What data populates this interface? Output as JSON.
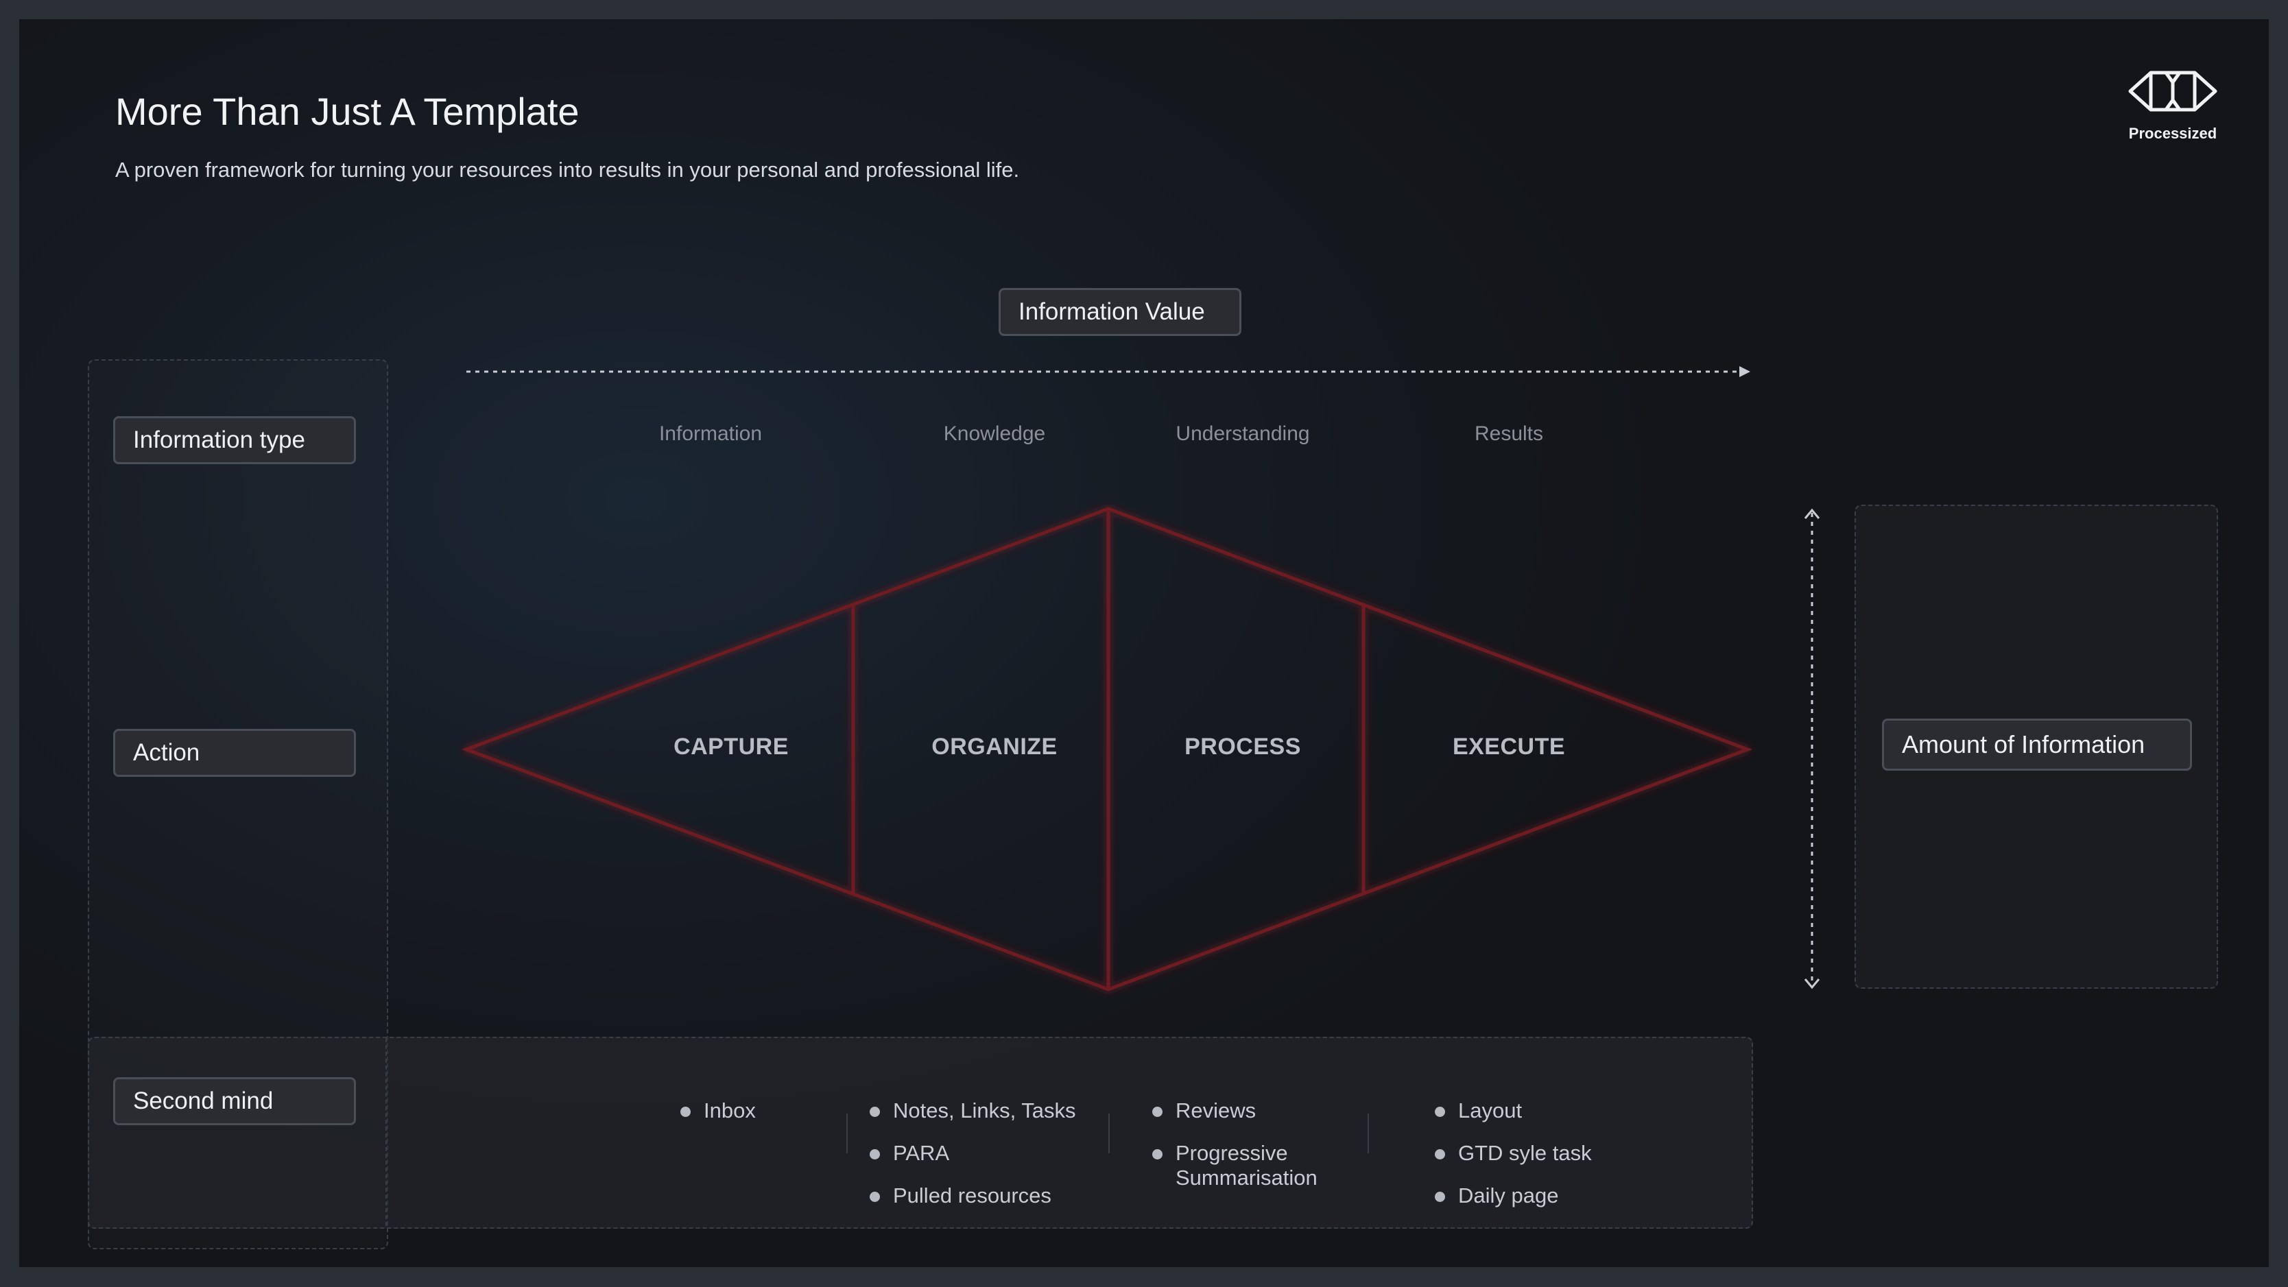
{
  "header": {
    "title": "More Than Just A Template",
    "subtitle": "A proven framework for turning your resources into results in your personal and professional life."
  },
  "logo": {
    "name": "Processized",
    "icon": "diamond-logo-icon"
  },
  "labels": {
    "information_type": "Information type",
    "action": "Action",
    "second_mind": "Second mind",
    "information_value": "Information Value",
    "amount_of_information": "Amount of Information"
  },
  "columns": [
    "Information",
    "Knowledge",
    "Understanding",
    "Results"
  ],
  "stages": [
    "CAPTURE",
    "ORGANIZE",
    "PROCESS",
    "EXECUTE"
  ],
  "second_mind_items": [
    [
      "Inbox"
    ],
    [
      "Notes, Links, Tasks",
      "PARA",
      "Pulled resources"
    ],
    [
      "Reviews",
      "Progressive Summarisation"
    ],
    [
      "Layout",
      "GTD syle task",
      "Daily page"
    ]
  ],
  "colors": {
    "accent_red": "#7a1c24",
    "background": "#161b22",
    "label_border": "#4a4e57"
  }
}
